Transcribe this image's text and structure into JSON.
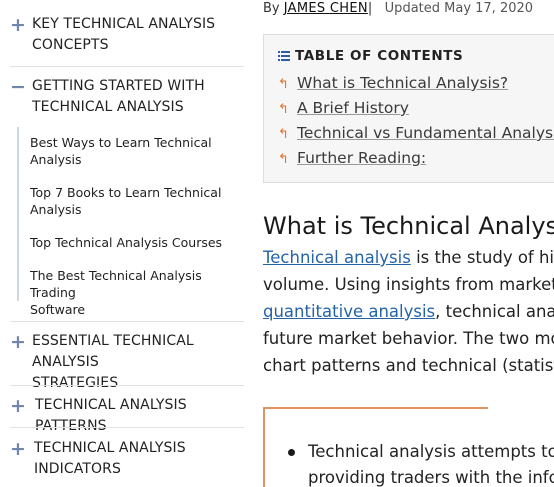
{
  "sidebar": {
    "sections": [
      {
        "icon": "plus-icon",
        "title_lines": [
          "KEY TECHNICAL ANALYSIS",
          "CONCEPTS"
        ]
      },
      {
        "icon": "minus-icon",
        "title_lines": [
          "GETTING STARTED WITH",
          "TECHNICAL ANALYSIS"
        ],
        "items": [
          {
            "lines": [
              "Best Ways to Learn Technical",
              "Analysis"
            ]
          },
          {
            "lines": [
              "Top 7 Books to Learn Technical",
              "Analysis"
            ]
          },
          {
            "lines": [
              "Top Technical Analysis Courses"
            ]
          },
          {
            "lines": [
              "The Best Technical Analysis Trading",
              "Software"
            ]
          }
        ]
      },
      {
        "icon": "plus-icon",
        "title_lines": [
          "ESSENTIAL TECHNICAL ANALYSIS",
          "STRATEGIES"
        ]
      },
      {
        "icon": "plus-icon",
        "title_lines": [
          "TECHNICAL ANALYSIS PATTERNS"
        ]
      },
      {
        "icon": "plus-icon",
        "title_lines": [
          "TECHNICAL ANALYSIS",
          "INDICATORS"
        ]
      }
    ]
  },
  "article": {
    "by_prefix": "By",
    "author": "JAMES CHEN",
    "separator": "|",
    "updated": "Updated May 17, 2020",
    "toc": {
      "heading": "TABLE OF CONTENTS",
      "items": [
        "What is Technical Analysis?",
        "A Brief History",
        "Technical vs Fundamental Analysis",
        "Further Reading:"
      ]
    },
    "heading": "What is Technical Analysis?",
    "para": {
      "line1_link": "Technical analysis",
      "line1_rest": " is the study of histor",
      "line2": "volume. Using insights from market psy",
      "line3_link": "quantitative analysis",
      "line3_rest": ", technical analyst",
      "line4": "future market behavior. The two most c",
      "line5": "chart patterns and technical (statistical"
    },
    "callout": {
      "bullet_line1": "Technical analysis attempts to pre",
      "bullet_line2": "providing traders with the inform"
    }
  },
  "colors": {
    "link": "#2563a8",
    "accent_orange": "#e0742e",
    "sidebar_icon": "#6f87ad",
    "toc_bg": "#f6f6f6"
  }
}
